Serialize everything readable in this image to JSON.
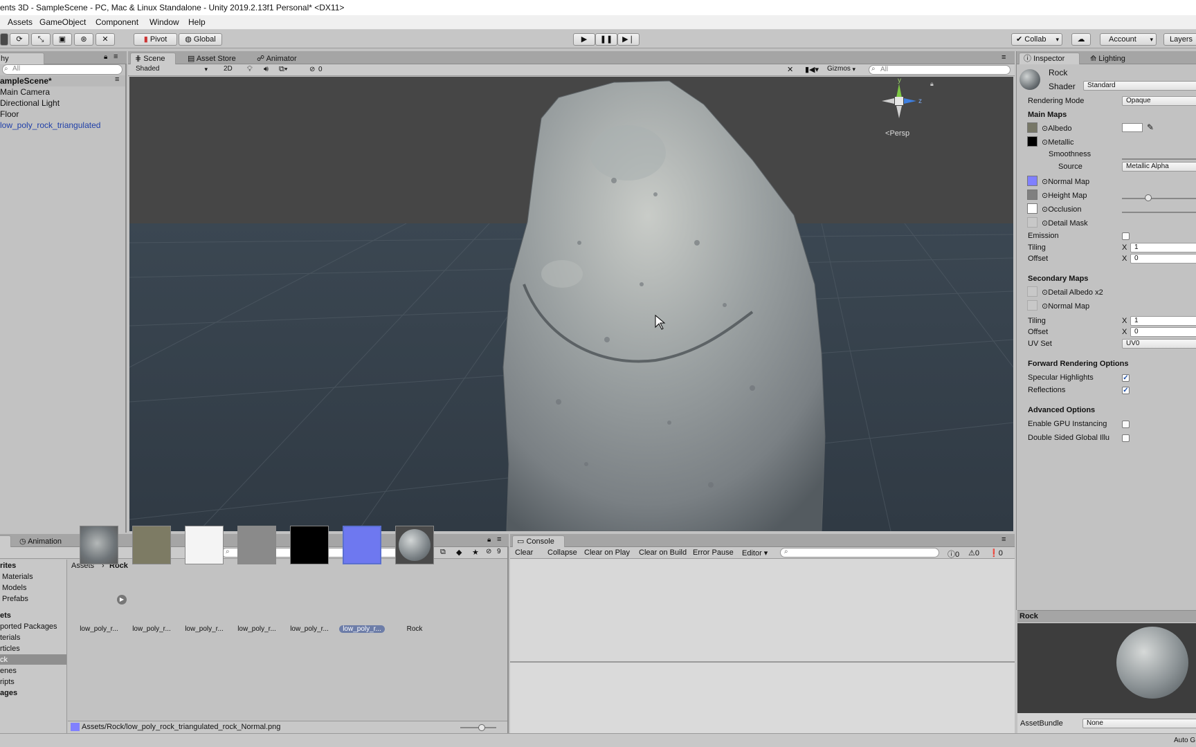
{
  "title": "ents 3D - SampleScene - PC, Mac & Linux Standalone - Unity 2019.2.13f1 Personal* <DX11>",
  "menu": [
    "Assets",
    "GameObject",
    "Component",
    "Window",
    "Help"
  ],
  "toolbar": {
    "pivot": "Pivot",
    "global": "Global",
    "collab": "Collab",
    "account": "Account",
    "layers": "Layers"
  },
  "hierarchy": {
    "tab": "hy",
    "search_placeholder": "All",
    "scene": "ampleScene*",
    "items": [
      "Main Camera",
      "Directional Light",
      "Floor",
      "low_poly_rock_triangulated"
    ]
  },
  "scene_view": {
    "tabs": [
      "Scene",
      "Asset Store",
      "Animator"
    ],
    "shading": "Shaded",
    "mode_2d": "2D",
    "hidden_count": "0",
    "gizmos": "Gizmos",
    "search_placeholder": "All",
    "persp": "Persp",
    "axis_y": "y",
    "axis_z": "z"
  },
  "inspector": {
    "tabs": [
      "Inspector",
      "Lighting"
    ],
    "material_name": "Rock",
    "shader_label": "Shader",
    "shader_value": "Standard",
    "rendering_mode_label": "Rendering Mode",
    "rendering_mode_value": "Opaque",
    "main_maps": "Main Maps",
    "albedo": "Albedo",
    "metallic": "Metallic",
    "smoothness": "Smoothness",
    "source_label": "Source",
    "source_value": "Metallic Alpha",
    "normal_map": "Normal Map",
    "height_map": "Height Map",
    "occlusion": "Occlusion",
    "detail_mask": "Detail Mask",
    "emission": "Emission",
    "tiling": "Tiling",
    "offset": "Offset",
    "x_label": "X",
    "main_tiling_x": "1",
    "main_offset_x": "0",
    "secondary_maps": "Secondary Maps",
    "detail_albedo": "Detail Albedo x2",
    "sec_normal_map": "Normal Map",
    "sec_tiling_x": "1",
    "sec_offset_x": "0",
    "uv_set_label": "UV Set",
    "uv_set_value": "UV0",
    "forward_options": "Forward Rendering Options",
    "specular_highlights": "Specular Highlights",
    "reflections": "Reflections",
    "advanced_options": "Advanced Options",
    "gpu_instancing": "Enable GPU Instancing",
    "double_sided": "Double Sided Global Illu",
    "height_slider": 0.35,
    "colors": {
      "albedo": "#777767",
      "metallic": "#000000",
      "normal": "#8080ff",
      "height": "#808080",
      "occlusion": "#ffffff"
    }
  },
  "preview": {
    "title": "Rock",
    "asset_bundle_label": "AssetBundle",
    "asset_bundle_value": "None",
    "auto": "Auto G"
  },
  "project": {
    "tab_animation": "Animation",
    "breadcrumb_root": "Assets",
    "breadcrumb_leaf": "Rock",
    "count": "9",
    "favorites_header": "rites",
    "favorites": [
      "Materials",
      "Models",
      "Prefabs"
    ],
    "assets_header": "ets",
    "folders": [
      "ported Packages",
      "terials",
      "rticles",
      "ck",
      "enes",
      "ripts"
    ],
    "packages_header": "ages",
    "assets": [
      {
        "label": "low_poly_r...",
        "kind": "mesh"
      },
      {
        "label": "low_poly_r...",
        "kind": "albedo"
      },
      {
        "label": "low_poly_r...",
        "kind": "white"
      },
      {
        "label": "low_poly_r...",
        "kind": "gray"
      },
      {
        "label": "low_poly_r...",
        "kind": "black"
      },
      {
        "label": "low_poly_r...",
        "kind": "normal"
      },
      {
        "label": "Rock",
        "kind": "material"
      }
    ],
    "selected_path": "Assets/Rock/low_poly_rock_triangulated_rock_Normal.png"
  },
  "console": {
    "tab": "Console",
    "buttons": [
      "Clear",
      "Collapse",
      "Clear on Play",
      "Clear on Build",
      "Error Pause",
      "Editor"
    ],
    "info_count": "0",
    "warn_count": "0",
    "error_count": "0"
  }
}
